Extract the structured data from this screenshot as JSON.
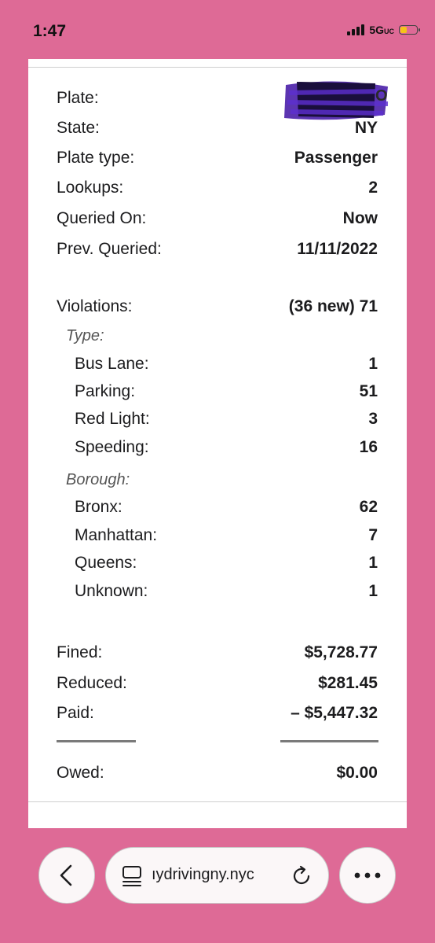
{
  "status": {
    "time": "1:47",
    "network": "5G",
    "network_suffix": "UC",
    "battery_level": 0.35,
    "battery_color": "#f5c518"
  },
  "report": {
    "plate": {
      "label": "Plate:",
      "value": ""
    },
    "state": {
      "label": "State:",
      "value": "NY"
    },
    "plate_type": {
      "label": "Plate type:",
      "value": "Passenger"
    },
    "lookups": {
      "label": "Lookups:",
      "value": "2"
    },
    "queried_on": {
      "label": "Queried On:",
      "value": "Now"
    },
    "prev_queried": {
      "label": "Prev. Queried:",
      "value": "11/11/2022"
    },
    "violations": {
      "label": "Violations:",
      "value": "(36 new) 71"
    },
    "type_heading": "Type:",
    "types": [
      {
        "label": "Bus Lane:",
        "value": "1"
      },
      {
        "label": "Parking:",
        "value": "51"
      },
      {
        "label": "Red Light:",
        "value": "3"
      },
      {
        "label": "Speeding:",
        "value": "16"
      }
    ],
    "borough_heading": "Borough:",
    "boroughs": [
      {
        "label": "Bronx:",
        "value": "62"
      },
      {
        "label": "Manhattan:",
        "value": "7"
      },
      {
        "label": "Queens:",
        "value": "1"
      },
      {
        "label": "Unknown:",
        "value": "1"
      }
    ],
    "fined": {
      "label": "Fined:",
      "value": "$5,728.77"
    },
    "reduced": {
      "label": "Reduced:",
      "value": "$281.45"
    },
    "paid": {
      "label": "Paid:",
      "value": "– $5,447.32"
    },
    "owed": {
      "label": "Owed:",
      "value": "$0.00"
    }
  },
  "toolbar": {
    "url": "ıydrivingny.nyc"
  },
  "colors": {
    "background": "#de6a96",
    "redaction": "#4a1fa8"
  }
}
